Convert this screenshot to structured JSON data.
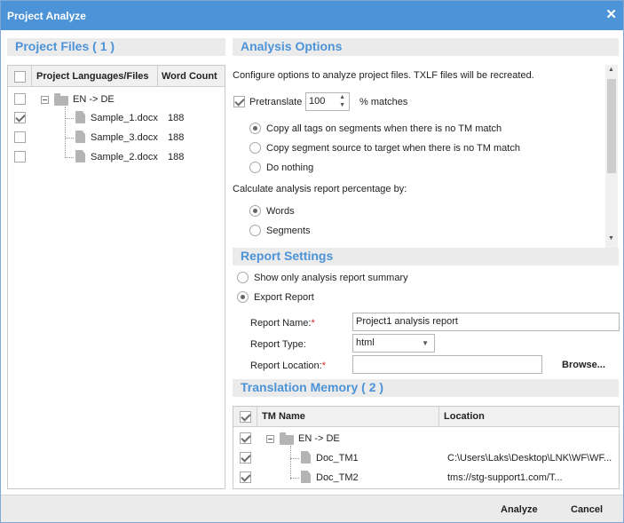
{
  "dialog": {
    "title": "Project Analyze",
    "close_glyph": "✕"
  },
  "project_files": {
    "header": "Project Files ( 1 )",
    "columns": [
      "Project Languages/Files",
      "Word Count"
    ],
    "language_pair": "EN -> DE",
    "files": [
      {
        "name": "Sample_1.docx",
        "word_count": "188",
        "checked": true
      },
      {
        "name": "Sample_3.docx",
        "word_count": "188",
        "checked": false
      },
      {
        "name": "Sample_2.docx",
        "word_count": "188",
        "checked": false
      }
    ]
  },
  "analysis_options": {
    "header": "Analysis Options",
    "intro": "Configure options to analyze project files. TXLF files will be recreated.",
    "pretranslate_label": "Pretranslate",
    "pretranslate_checked": true,
    "match_value": "100",
    "match_suffix": "% matches",
    "copy_options": [
      "Copy all tags on segments when there is no TM match",
      "Copy segment source to target when there is no TM match",
      "Do nothing"
    ],
    "copy_selected_index": 0,
    "percentage_label": "Calculate analysis report percentage by:",
    "percentage_options": [
      "Words",
      "Segments"
    ],
    "percentage_selected_index": 0
  },
  "report_settings": {
    "header": "Report Settings",
    "options": [
      "Show only analysis report summary",
      "Export Report"
    ],
    "selected_index": 1,
    "name_label": "Report Name:",
    "name_value": "Project1 analysis report",
    "type_label": "Report Type:",
    "type_value": "html",
    "location_label": "Report Location:",
    "location_value": "",
    "required_mark": "*",
    "browse_label": "Browse..."
  },
  "translation_memory": {
    "header": "Translation Memory ( 2 )",
    "columns": [
      "TM Name",
      "Location"
    ],
    "language_pair": "EN -> DE",
    "items": [
      {
        "name": "Doc_TM1",
        "location": "C:\\Users\\Laks\\Desktop\\LNK\\WF\\WF...",
        "checked": true
      },
      {
        "name": "Doc_TM2",
        "location": "tms://stg-support1.com/T...",
        "checked": true
      }
    ]
  },
  "footer": {
    "analyze_label": "Analyze",
    "cancel_label": "Cancel"
  },
  "colors": {
    "accent": "#4c93d8",
    "section_bg": "#ebebeb",
    "required": "#dd2222"
  }
}
